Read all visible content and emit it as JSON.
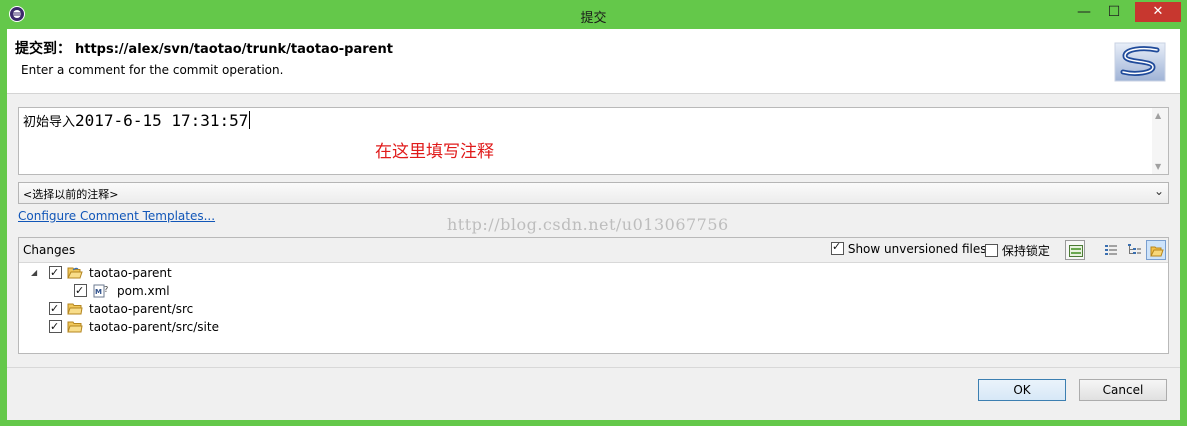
{
  "window": {
    "title": "提交",
    "minimize": "—",
    "maximize": "☐",
    "close": "✕"
  },
  "header": {
    "label": "提交到：",
    "url": "https://alex/svn/taotao/trunk/taotao-parent",
    "subtitle": "Enter a comment for the commit operation."
  },
  "comment": {
    "prefix": "初始导入",
    "value": "2017-6-15 17:31:57",
    "annotation": "在这里填写注释"
  },
  "previous_comments": {
    "selected": "<选择以前的注释>"
  },
  "configure_link": "Configure Comment Templates...",
  "watermark": "http://blog.csdn.net/u013067756",
  "changes": {
    "label": "Changes",
    "show_unversioned": {
      "label": "Show unversioned files",
      "checked": true
    },
    "keep_locks": {
      "label": "保持锁定",
      "checked": false
    },
    "items": [
      {
        "name": "taotao-parent",
        "checked": true,
        "expanded": true,
        "icon": "folder-open-icon"
      },
      {
        "name": "pom.xml",
        "checked": true,
        "icon": "xml-file-icon"
      },
      {
        "name": "taotao-parent/src",
        "checked": true,
        "icon": "folder-icon"
      },
      {
        "name": "taotao-parent/src/site",
        "checked": true,
        "icon": "folder-icon"
      }
    ]
  },
  "buttons": {
    "ok": "OK",
    "cancel": "Cancel"
  },
  "colors": {
    "titlebar": "#64c84a",
    "annotation": "#e01b1b",
    "link": "#1156b8"
  }
}
